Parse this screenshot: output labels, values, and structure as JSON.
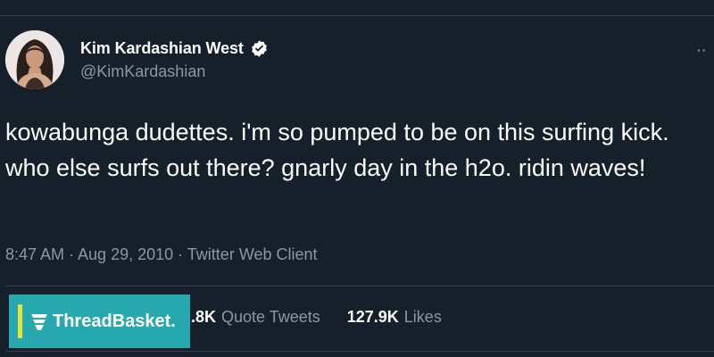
{
  "author": {
    "display_name": "Kim Kardashian West",
    "handle": "@KimKardashian"
  },
  "tweet": {
    "text": "kowabunga dudettes. i'm so pumped to be on this surfing kick. who else surfs out there? gnarly day in the h2o. ridin waves!",
    "meta": "8:47 AM · Aug 29, 2010 · Twitter Web Client"
  },
  "stats": {
    "quote_tweets_count": ".8K",
    "quote_tweets_label": "Quote Tweets",
    "likes_count": "127.9K",
    "likes_label": "Likes"
  },
  "more_button": {
    "glyph": "··"
  },
  "watermark": {
    "text": "ThreadBasket."
  },
  "colors": {
    "background": "#15202b",
    "verified": "#ffffff",
    "watermark_bg": "#26a8ae",
    "watermark_accent": "#e7e23a"
  }
}
